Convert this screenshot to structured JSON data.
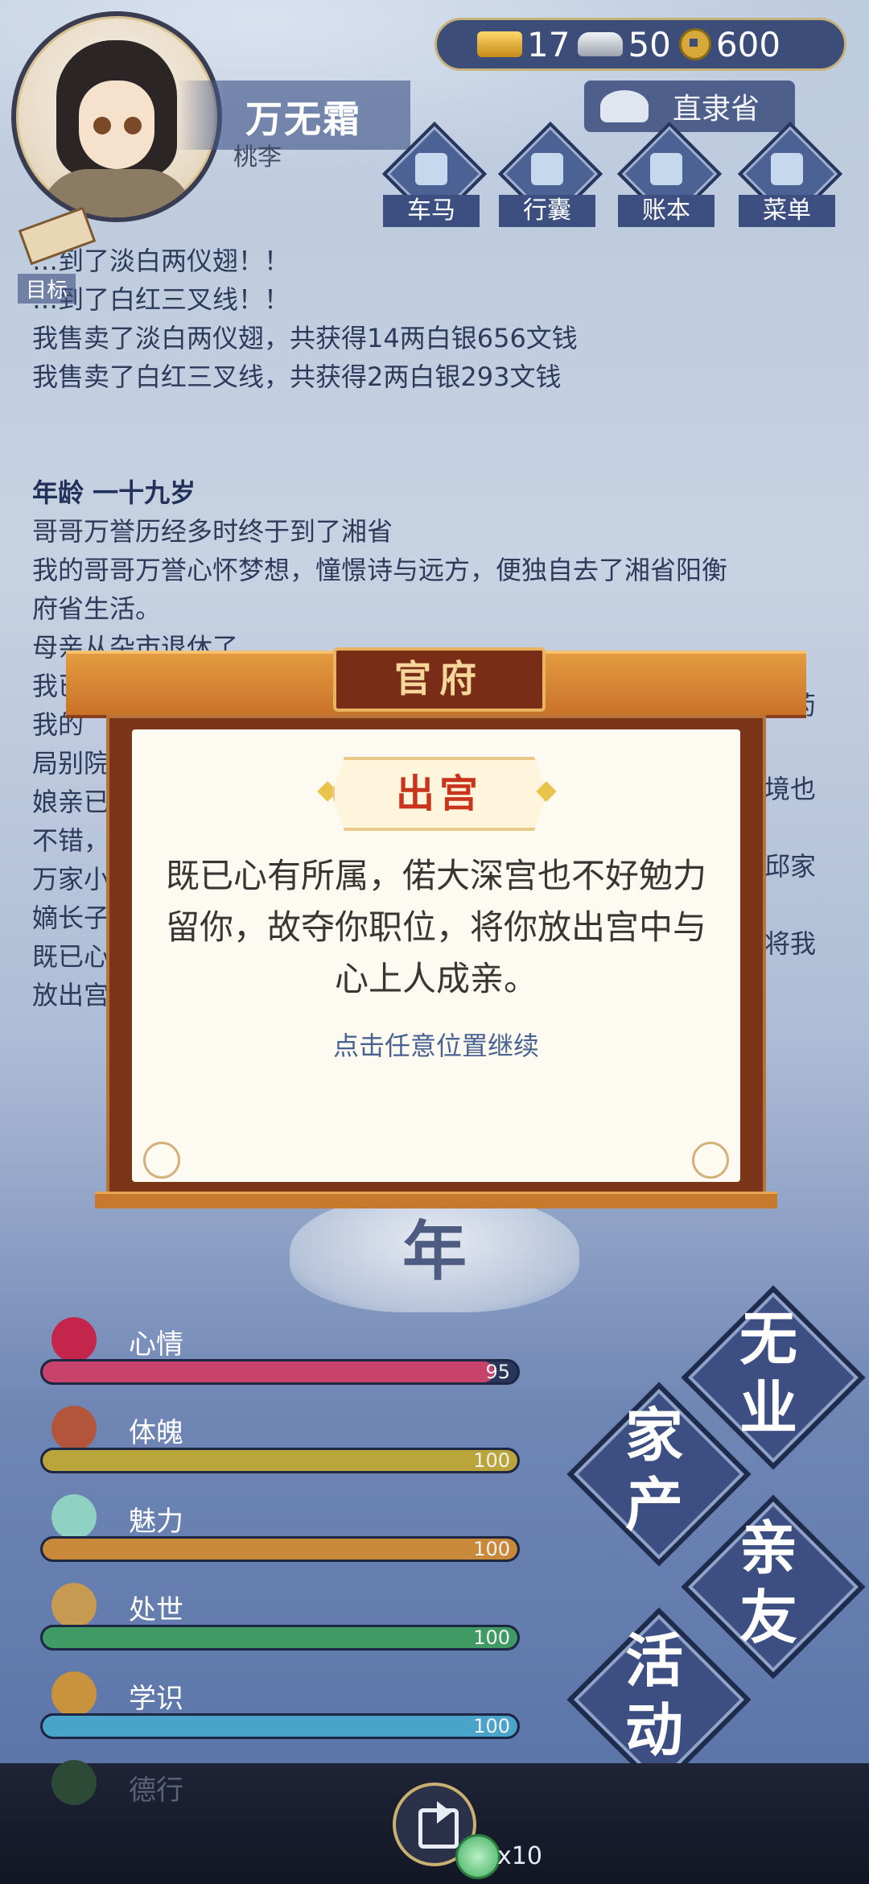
{
  "player": {
    "name": "万无霜",
    "sub": "桃李"
  },
  "currency": {
    "gold": "17",
    "silver": "50",
    "coins": "600"
  },
  "region": {
    "label": "直隶省"
  },
  "nav": [
    {
      "label": "车马",
      "icon": "carriage-icon"
    },
    {
      "label": "行囊",
      "icon": "bag-icon"
    },
    {
      "label": "账本",
      "icon": "ledger-icon"
    },
    {
      "label": "菜单",
      "icon": "menu-icon"
    }
  ],
  "goal": {
    "label": "目标"
  },
  "log": {
    "lines_before": [
      "…到了淡白两仪翅！！",
      "…到了白红三叉线！！",
      "我售卖了淡白两仪翅，共获得14两白银656文钱",
      "我售卖了白红三叉线，共获得2两白银293文钱"
    ],
    "age_heading": "年龄 一十九岁",
    "lines_after": [
      "哥哥万誉历经多时终于到了湘省",
      "我的哥哥万誉心怀梦想，憧憬诗与远方，便独自去了湘省阳衡",
      "府省生活。",
      "母亲从杂市退休了",
      "我已",
      "我的",
      "局别院",
      "娘亲已",
      "不错，",
      "万家小",
      "嫡长子",
      "既已心",
      "放出宫"
    ],
    "lines_right": [
      "局药",
      "境也",
      "邱家",
      "将我"
    ]
  },
  "modal": {
    "header": "官府",
    "title": "出宫",
    "body": "既已心有所属，偌大深宫也不好勉力留你，故夺你职位，将你放出宫中与心上人成亲。",
    "continue": "点击任意位置继续"
  },
  "year": {
    "char": "年"
  },
  "stats": [
    {
      "label": "心情",
      "value": 95,
      "color": "#c8436b",
      "icon": "flower-icon"
    },
    {
      "label": "体魄",
      "value": 100,
      "color": "#b9a53a",
      "icon": "body-icon"
    },
    {
      "label": "魅力",
      "value": 100,
      "color": "#c88a3a",
      "icon": "mirror-icon"
    },
    {
      "label": "处世",
      "value": 100,
      "color": "#3f9a63",
      "icon": "worldly-icon"
    },
    {
      "label": "学识",
      "value": 100,
      "color": "#4aa3c8",
      "icon": "books-icon"
    }
  ],
  "virtue": {
    "label": "德行"
  },
  "categories": {
    "unemployed": "无业",
    "estate": "家产",
    "relatives": "亲友",
    "activity": "活动"
  },
  "bottom": {
    "jade_count": "x10"
  }
}
